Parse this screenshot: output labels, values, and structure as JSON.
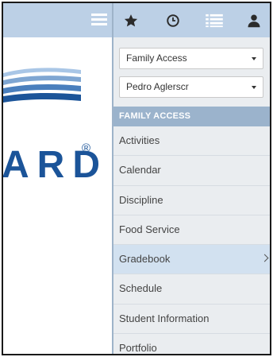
{
  "logo": {
    "text": "ARD",
    "registered": "®"
  },
  "topbar": {
    "icons": [
      "star-icon",
      "clock-icon",
      "list-icon",
      "user-icon"
    ]
  },
  "selects": {
    "access": "Family Access",
    "student": "Pedro Aglerscr"
  },
  "menu": {
    "section_title": "FAMILY ACCESS",
    "items": [
      {
        "label": "Activities"
      },
      {
        "label": "Calendar"
      },
      {
        "label": "Discipline"
      },
      {
        "label": "Food Service"
      },
      {
        "label": "Gradebook"
      },
      {
        "label": "Schedule"
      },
      {
        "label": "Student Information"
      },
      {
        "label": "Portfolio"
      }
    ]
  },
  "colors": {
    "header_bg": "#bcd0e6",
    "section_bg": "#9bb3cc",
    "active_item_bg": "#d2e1f0",
    "logo_blue": "#1b5499"
  }
}
